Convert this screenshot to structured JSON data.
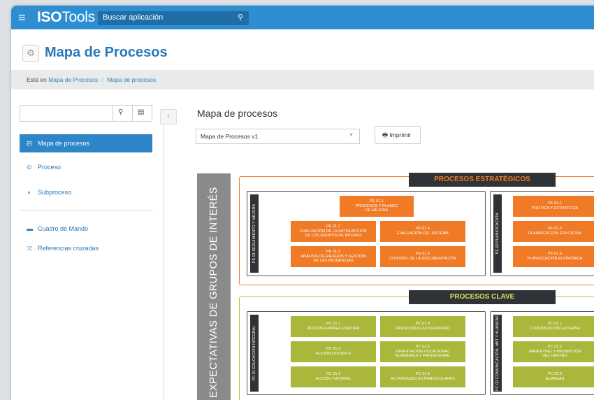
{
  "topbar": {
    "brand_bold": "ISO",
    "brand_rest": "Tools",
    "search_placeholder": "Buscar aplicación",
    "hamburger": "≡",
    "search_icon": "⚲"
  },
  "page": {
    "title": "Mapa de Procesos"
  },
  "breadcrumb": {
    "prefix": "Está en",
    "item1": "Mapa de Procesos",
    "sep": "/",
    "item2": "Mapa de procesos"
  },
  "sidebar": {
    "items": [
      {
        "icon": "⊟",
        "label": "Mapa de procesos",
        "active": true
      },
      {
        "icon": "⊙",
        "label": "Proceso"
      },
      {
        "icon": "◑",
        "label": "Subproceso"
      },
      {
        "icon": "▬",
        "label": "Cuadro de Mando"
      },
      {
        "icon": "⤨",
        "label": "Referencias cruzadas"
      }
    ]
  },
  "content": {
    "title": "Mapa de procesos",
    "select_value": "Mapa de Procesos v1",
    "print_label": "Imprimir",
    "print_icon": "🖶"
  },
  "map": {
    "side_label": "EXPECTATIVAS DE GRUPOS DE INTERÉS",
    "estrategicos": {
      "header": "PROCESOS ESTRATÉGICOS",
      "group1": {
        "label": "PE 01 SEGUIMIENTO Y MEJORA",
        "boxes": [
          {
            "code": "PE 01.1",
            "name": "PROCESOS Y PLANES\nDE MEJORA"
          },
          {
            "code": "PE 01.2",
            "name": "EVALUACIÓN DE LA SATISFACCIÓN\nDE LOS GRUPOS DE INTERÉS"
          },
          {
            "code": "PE 01.4",
            "name": "EVALUACIÓN DEL SISTEMA"
          },
          {
            "code": "PE 01.3",
            "name": "ANÁLISIS DE RIESGOS Y GESTIÓN\nDE LAS INCIDENCIAS"
          },
          {
            "code": "PE 01.5",
            "name": "CONTROL DE LA DOCUMENTACIÓN"
          }
        ]
      },
      "group2": {
        "label": "PE 02 PLANIFICACIÓN",
        "boxes": [
          {
            "code": "PE 02.1",
            "name": "POLÍTICA Y ESTRATEGIA"
          },
          {
            "code": "PE 02.2",
            "name": "PLANIFICACIÓN EDUCATIVA"
          },
          {
            "code": "PE 02.4",
            "name": "PLANIFICACIÓN ECONÓMICA"
          }
        ]
      }
    },
    "clave": {
      "header": "PROCESOS CLAVE",
      "group1": {
        "label": "PC 01 EDUCACIÓN INTEGRAL",
        "boxes": [
          {
            "code": "PC 01.1",
            "name": "ACCIÓN EVANGELIZADORA"
          },
          {
            "code": "PC 01.4",
            "name": "ATENCIÓN A LA DIVERSIDAD"
          },
          {
            "code": "PC 01.2",
            "name": "ACCIÓN DOCENTE"
          },
          {
            "code": "PC 01.5",
            "name": "ORIENTACIÓN VOCACIONAL\nACADÉMICA Y PROFESIONAL"
          },
          {
            "code": "PC 01.3",
            "name": "ACCIÓN TUTORIAL"
          },
          {
            "code": "PC 01.6",
            "name": "ACTIVIDADES EXTRAESCOLARES"
          }
        ]
      },
      "group2": {
        "label": "PC 02 COMUNICACIÓN, MKT Y ALIANZAS",
        "boxes": [
          {
            "code": "PC 02.1",
            "name": "COMUNICACIÓN EXTERNA"
          },
          {
            "code": "PC 02.2",
            "name": "MARKETING Y PROMOCIÓN\nDEL CENTRO"
          },
          {
            "code": "PC 02.3",
            "name": "ALIANZAS"
          }
        ]
      }
    }
  },
  "colors": {
    "topbar": "#2d8fd1",
    "accent": "#2d86c7",
    "estrategicos": "#f07a26",
    "clave": "#aab73b"
  }
}
